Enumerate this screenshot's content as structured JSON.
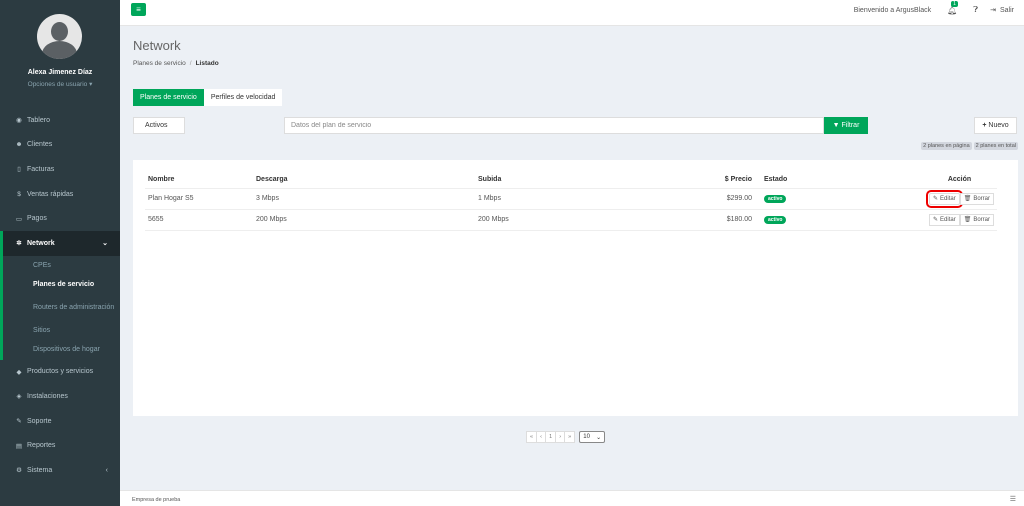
{
  "sidebar": {
    "user_name": "Alexa Jimenez Díaz",
    "user_options": "Opciones de usuario ▾",
    "items": [
      {
        "label": "Tablero",
        "icon": "dashboard-icon"
      },
      {
        "label": "Clientes",
        "icon": "users-icon"
      },
      {
        "label": "Facturas",
        "icon": "file-icon"
      },
      {
        "label": "Ventas rápidas",
        "icon": "dollar-icon"
      },
      {
        "label": "Pagos",
        "icon": "money-icon"
      },
      {
        "label": "Network",
        "icon": "network-icon"
      },
      {
        "label": "Productos y servicios",
        "icon": "tag-icon"
      },
      {
        "label": "Instalaciones",
        "icon": "wrench-icon"
      },
      {
        "label": "Soporte",
        "icon": "support-icon"
      },
      {
        "label": "Reportes",
        "icon": "report-icon"
      },
      {
        "label": "Sistema",
        "icon": "cogs-icon"
      }
    ],
    "network_sub": [
      {
        "label": "CPEs"
      },
      {
        "label": "Planes de servicio"
      },
      {
        "label": "Routers de administración"
      },
      {
        "label": "Sitios"
      },
      {
        "label": "Dispositivos de hogar"
      }
    ]
  },
  "topbar": {
    "welcome": "Bienvenido a ArgusBlack",
    "notifications": "1",
    "logout": "Salir"
  },
  "header": {
    "title": "Network",
    "breadcrumb_parent": "Planes de servicio",
    "breadcrumb_sep": "/",
    "breadcrumb_current": "Listado"
  },
  "tabs": [
    {
      "label": "Planes de servicio"
    },
    {
      "label": "Perfiles de velocidad"
    }
  ],
  "filters": {
    "status": "Activos",
    "search_placeholder": "Datos del plan de servicio",
    "filter_button": "Filtrar",
    "new_button": "Nuevo",
    "count_page": "2 planes en página",
    "count_total": "2 planes en total"
  },
  "table": {
    "headers": {
      "name": "Nombre",
      "download": "Descarga",
      "upload": "Subida",
      "price": "$ Precio",
      "status": "Estado",
      "action": "Acción"
    },
    "rows": [
      {
        "name": "Plan Hogar S5",
        "download": "3 Mbps",
        "upload": "1 Mbps",
        "price": "$299.00",
        "status": "activo"
      },
      {
        "name": "5655",
        "download": "200 Mbps",
        "upload": "200 Mbps",
        "price": "$180.00",
        "status": "activo"
      }
    ],
    "edit_label": "Editar",
    "delete_label": "Borrar"
  },
  "pagination": {
    "first": "«",
    "prev": "‹",
    "page": "1",
    "next": "›",
    "last": "»",
    "page_size": "10"
  },
  "footer": {
    "company": "Empresa de prueba"
  },
  "colors": {
    "accent": "#00a65a",
    "sidebar": "#2c3b41",
    "highlight": "#e00000"
  }
}
